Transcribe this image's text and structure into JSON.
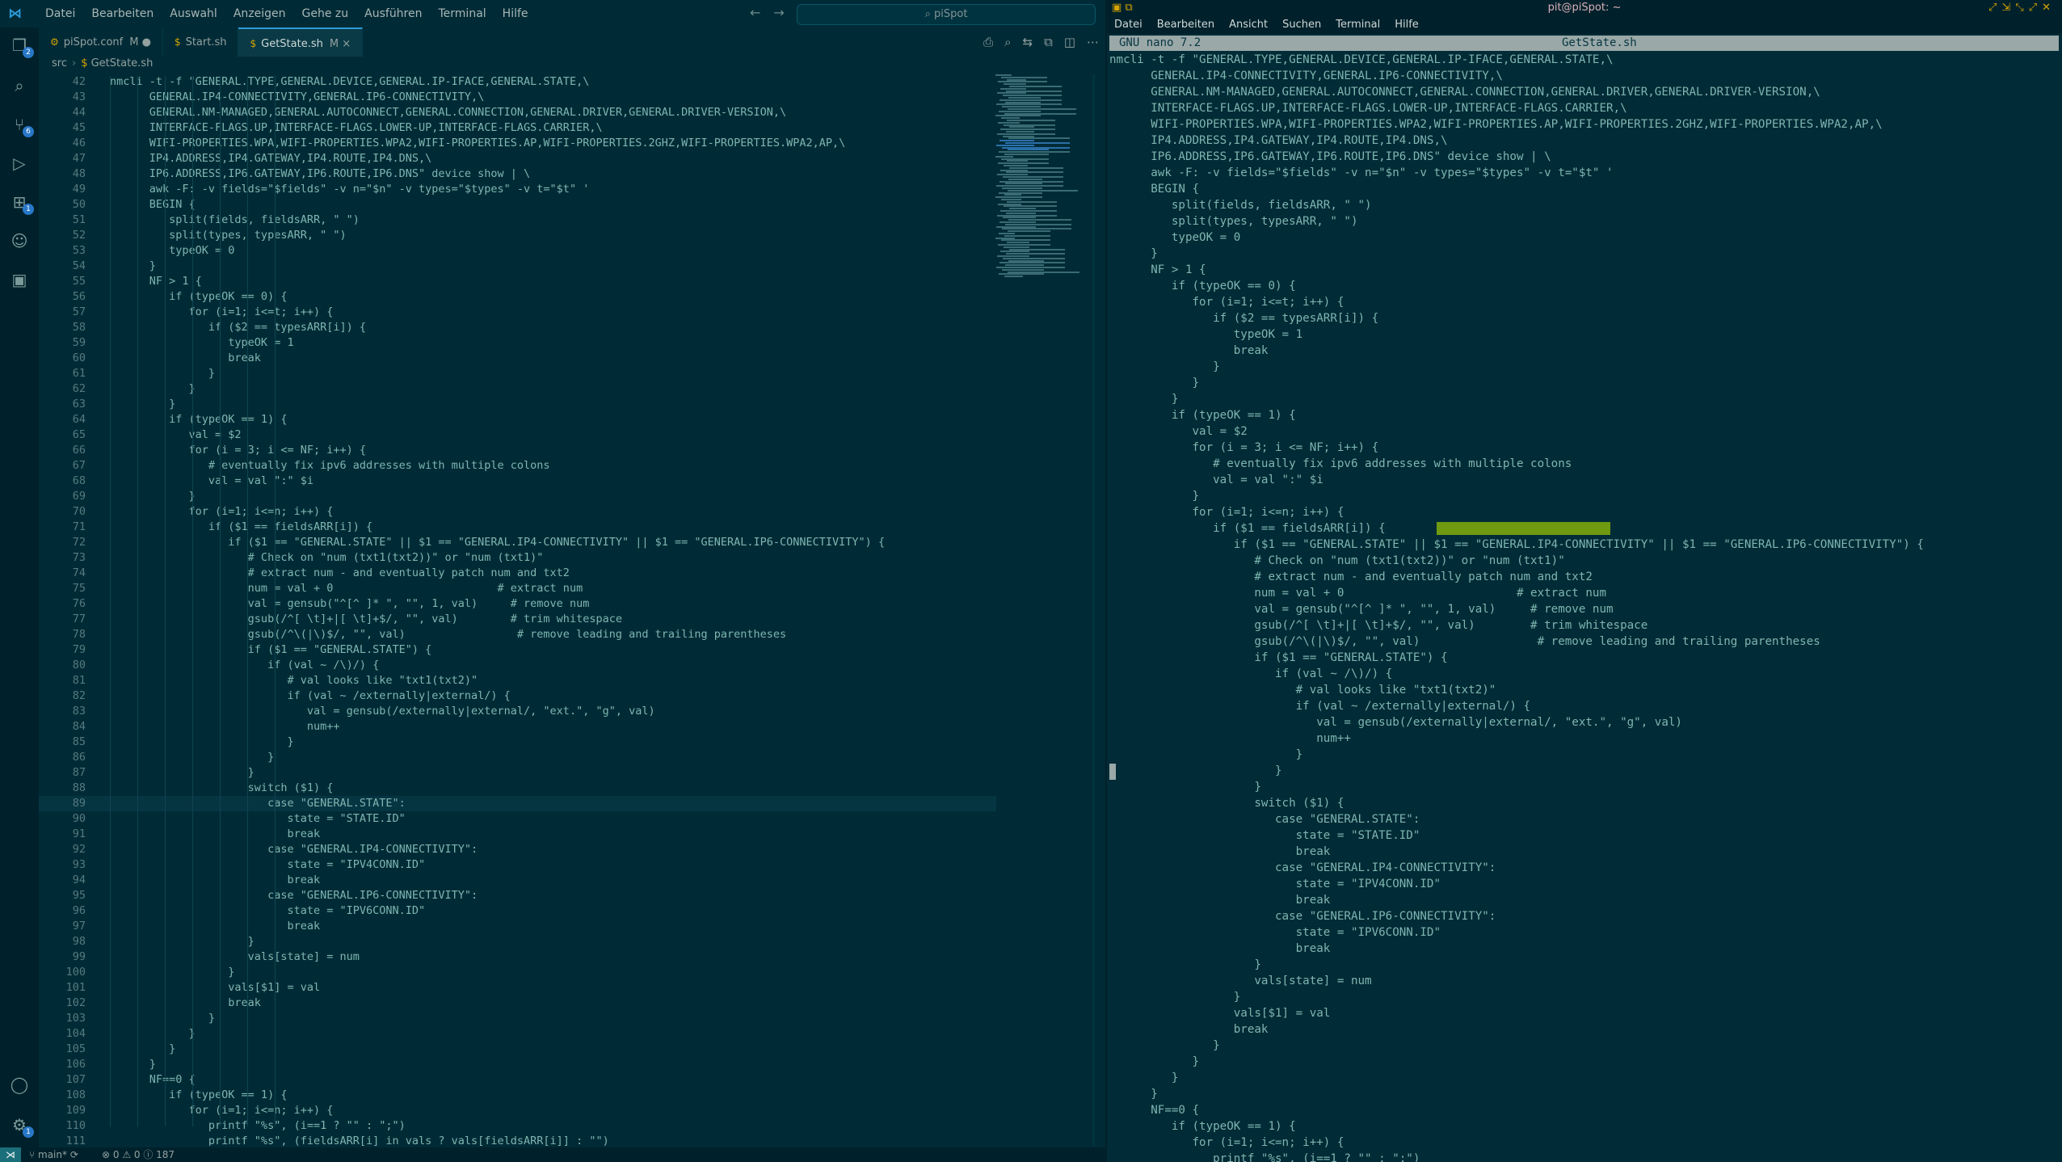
{
  "vscode": {
    "menu": [
      "Datei",
      "Bearbeiten",
      "Auswahl",
      "Anzeigen",
      "Gehe zu",
      "Ausführen",
      "Terminal",
      "Hilfe"
    ],
    "search_label": "piSpot",
    "tabs": [
      {
        "label": "piSpot.conf",
        "suffix": "M ●"
      },
      {
        "label": "Start.sh",
        "suffix": ""
      },
      {
        "label": "GetState.sh",
        "suffix": "M ×"
      }
    ],
    "breadcrumb": [
      "src",
      "GetState.sh"
    ],
    "badges": {
      "explorer": "2",
      "scm": "6",
      "extensions": "1",
      "settings": "1"
    },
    "status": {
      "branch": "main*",
      "problems": "⊗ 0 ⚠ 0 ⓘ 187"
    },
    "current_line": 89,
    "lines": [
      {
        "n": "42",
        "t": "nmcli -t -f \"GENERAL.TYPE,GENERAL.DEVICE,GENERAL.IP-IFACE,GENERAL.STATE,\\"
      },
      {
        "n": "43",
        "t": "      GENERAL.IP4-CONNECTIVITY,GENERAL.IP6-CONNECTIVITY,\\"
      },
      {
        "n": "44",
        "t": "      GENERAL.NM-MANAGED,GENERAL.AUTOCONNECT,GENERAL.CONNECTION,GENERAL.DRIVER,GENERAL.DRIVER-VERSION,\\"
      },
      {
        "n": "45",
        "t": "      INTERFACE-FLAGS.UP,INTERFACE-FLAGS.LOWER-UP,INTERFACE-FLAGS.CARRIER,\\"
      },
      {
        "n": "46",
        "t": "      WIFI-PROPERTIES.WPA,WIFI-PROPERTIES.WPA2,WIFI-PROPERTIES.AP,WIFI-PROPERTIES.2GHZ,WIFI-PROPERTIES.WPA2,AP,\\"
      },
      {
        "n": "47",
        "t": "      IP4.ADDRESS,IP4.GATEWAY,IP4.ROUTE,IP4.DNS,\\"
      },
      {
        "n": "48",
        "t": "      IP6.ADDRESS,IP6.GATEWAY,IP6.ROUTE,IP6.DNS\" device show | \\"
      },
      {
        "n": "49",
        "t": "      awk -F: -v fields=\"$fields\" -v n=\"$n\" -v types=\"$types\" -v t=\"$t\" '"
      },
      {
        "n": "50",
        "t": "      BEGIN {"
      },
      {
        "n": "51",
        "t": "         split(fields, fieldsARR, \" \")"
      },
      {
        "n": "52",
        "t": "         split(types, typesARR, \" \")"
      },
      {
        "n": "53",
        "t": "         typeOK = 0"
      },
      {
        "n": "54",
        "t": "      }"
      },
      {
        "n": "55",
        "t": "      NF > 1 {"
      },
      {
        "n": "56",
        "t": "         if (typeOK == 0) {"
      },
      {
        "n": "57",
        "t": "            for (i=1; i<=t; i++) {"
      },
      {
        "n": "58",
        "t": "               if ($2 == typesARR[i]) {"
      },
      {
        "n": "59",
        "t": "                  typeOK = 1"
      },
      {
        "n": "60",
        "t": "                  break"
      },
      {
        "n": "61",
        "t": "               }"
      },
      {
        "n": "62",
        "t": "            }"
      },
      {
        "n": "63",
        "t": "         }"
      },
      {
        "n": "64",
        "t": "         if (typeOK == 1) {"
      },
      {
        "n": "65",
        "t": "            val = $2"
      },
      {
        "n": "66",
        "t": "            for (i = 3; i <= NF; i++) {"
      },
      {
        "n": "67",
        "t": "               # eventually fix ipv6 addresses with multiple colons"
      },
      {
        "n": "68",
        "t": "               val = val \":\" $i"
      },
      {
        "n": "69",
        "t": "            }"
      },
      {
        "n": "70",
        "t": "            for (i=1; i<=n; i++) {"
      },
      {
        "n": "71",
        "t": "               if ($1 == fieldsARR[i]) {"
      },
      {
        "n": "72",
        "t": "                  if ($1 == \"GENERAL.STATE\" || $1 == \"GENERAL.IP4-CONNECTIVITY\" || $1 == \"GENERAL.IP6-CONNECTIVITY\") {"
      },
      {
        "n": "73",
        "t": "                     # Check on \"num (txt1(txt2))\" or \"num (txt1)\""
      },
      {
        "n": "74",
        "t": "                     # extract num - and eventually patch num and txt2"
      },
      {
        "n": "75",
        "t": "                     num = val + 0                         # extract num"
      },
      {
        "n": "76",
        "t": "                     val = gensub(\"^[^ ]* \", \"\", 1, val)     # remove num"
      },
      {
        "n": "77",
        "t": "                     gsub(/^[ \\t]+|[ \\t]+$/, \"\", val)        # trim whitespace"
      },
      {
        "n": "78",
        "t": "                     gsub(/^\\(|\\)$/, \"\", val)                 # remove leading and trailing parentheses"
      },
      {
        "n": "79",
        "t": "                     if ($1 == \"GENERAL.STATE\") {"
      },
      {
        "n": "80",
        "t": "                        if (val ~ /\\)/) {"
      },
      {
        "n": "81",
        "t": "                           # val looks like \"txt1(txt2)\""
      },
      {
        "n": "82",
        "t": "                           if (val ~ /externally|external/) {"
      },
      {
        "n": "83",
        "t": "                              val = gensub(/externally|external/, \"ext.\", \"g\", val)"
      },
      {
        "n": "84",
        "t": "                              num++"
      },
      {
        "n": "85",
        "t": "                           }"
      },
      {
        "n": "86",
        "t": "                        }"
      },
      {
        "n": "87",
        "t": "                     }"
      },
      {
        "n": "88",
        "t": "                     switch ($1) {"
      },
      {
        "n": "89",
        "t": "                        case \"GENERAL.STATE\":"
      },
      {
        "n": "90",
        "t": "                           state = \"STATE.ID\""
      },
      {
        "n": "91",
        "t": "                           break"
      },
      {
        "n": "92",
        "t": "                        case \"GENERAL.IP4-CONNECTIVITY\":"
      },
      {
        "n": "93",
        "t": "                           state = \"IPV4CONN.ID\""
      },
      {
        "n": "94",
        "t": "                           break"
      },
      {
        "n": "95",
        "t": "                        case \"GENERAL.IP6-CONNECTIVITY\":"
      },
      {
        "n": "96",
        "t": "                           state = \"IPV6CONN.ID\""
      },
      {
        "n": "97",
        "t": "                           break"
      },
      {
        "n": "98",
        "t": "                     }"
      },
      {
        "n": "99",
        "t": "                     vals[state] = num"
      },
      {
        "n": "100",
        "t": "                  }"
      },
      {
        "n": "101",
        "t": "                  vals[$1] = val"
      },
      {
        "n": "102",
        "t": "                  break"
      },
      {
        "n": "103",
        "t": "               }"
      },
      {
        "n": "104",
        "t": "            }"
      },
      {
        "n": "105",
        "t": "         }"
      },
      {
        "n": "106",
        "t": "      }"
      },
      {
        "n": "107",
        "t": "      NF==0 {"
      },
      {
        "n": "108",
        "t": "         if (typeOK == 1) {"
      },
      {
        "n": "109",
        "t": "            for (i=1; i<=n; i++) {"
      },
      {
        "n": "110",
        "t": "               printf \"%s\", (i==1 ? \"\" : \";\")"
      },
      {
        "n": "111",
        "t": "               printf \"%s\", (fieldsARR[i] in vals ? vals[fieldsARR[i]] : \"\")"
      }
    ]
  },
  "terminal": {
    "title": "pit@piSpot: ~",
    "menu": [
      "Datei",
      "Bearbeiten",
      "Ansicht",
      "Suchen",
      "Terminal",
      "Hilfe"
    ],
    "nano_version": "GNU nano 7.2",
    "nano_filename": "GetState.sh",
    "lines": [
      "nmcli -t -f \"GENERAL.TYPE,GENERAL.DEVICE,GENERAL.IP-IFACE,GENERAL.STATE,\\",
      "      GENERAL.IP4-CONNECTIVITY,GENERAL.IP6-CONNECTIVITY,\\",
      "      GENERAL.NM-MANAGED,GENERAL.AUTOCONNECT,GENERAL.CONNECTION,GENERAL.DRIVER,GENERAL.DRIVER-VERSION,\\",
      "      INTERFACE-FLAGS.UP,INTERFACE-FLAGS.LOWER-UP,INTERFACE-FLAGS.CARRIER,\\",
      "      WIFI-PROPERTIES.WPA,WIFI-PROPERTIES.WPA2,WIFI-PROPERTIES.AP,WIFI-PROPERTIES.2GHZ,WIFI-PROPERTIES.WPA2,AP,\\",
      "      IP4.ADDRESS,IP4.GATEWAY,IP4.ROUTE,IP4.DNS,\\",
      "      IP6.ADDRESS,IP6.GATEWAY,IP6.ROUTE,IP6.DNS\" device show | \\",
      "      awk -F: -v fields=\"$fields\" -v n=\"$n\" -v types=\"$types\" -v t=\"$t\" '",
      "      BEGIN {",
      "         split(fields, fieldsARR, \" \")",
      "         split(types, typesARR, \" \")",
      "         typeOK = 0",
      "      }",
      "      NF > 1 {",
      "         if (typeOK == 0) {",
      "            for (i=1; i<=t; i++) {",
      "               if ($2 == typesARR[i]) {",
      "                  typeOK = 1",
      "                  break",
      "               }",
      "            }",
      "         }",
      "         if (typeOK == 1) {",
      "            val = $2",
      "            for (i = 3; i <= NF; i++) {",
      "               # eventually fix ipv6 addresses with multiple colons",
      "               val = val \":\" $i",
      "            }",
      "            for (i=1; i<=n; i++) {",
      "               if ($1 == fieldsARR[i]) {",
      "                  if ($1 == \"GENERAL.STATE\" || $1 == \"GENERAL.IP4-CONNECTIVITY\" || $1 == \"GENERAL.IP6-CONNECTIVITY\") {",
      "                     # Check on \"num (txt1(txt2))\" or \"num (txt1)\"",
      "                     # extract num - and eventually patch num and txt2",
      "                     num = val + 0                         # extract num",
      "                     val = gensub(\"^[^ ]* \", \"\", 1, val)     # remove num",
      "                     gsub(/^[ \\t]+|[ \\t]+$/, \"\", val)        # trim whitespace",
      "                     gsub(/^\\(|\\)$/, \"\", val)                 # remove leading and trailing parentheses",
      "                     if ($1 == \"GENERAL.STATE\") {",
      "                        if (val ~ /\\)/) {",
      "                           # val looks like \"txt1(txt2)\"",
      "                           if (val ~ /externally|external/) {",
      "                              val = gensub(/externally|external/, \"ext.\", \"g\", val)",
      "                              num++",
      "                           }",
      "                        }",
      "                     }",
      "                     switch ($1) {",
      "                        case \"GENERAL.STATE\":",
      "                           state = \"STATE.ID\"",
      "                           break",
      "                        case \"GENERAL.IP4-CONNECTIVITY\":",
      "                           state = \"IPV4CONN.ID\"",
      "                           break",
      "                        case \"GENERAL.IP6-CONNECTIVITY\":",
      "                           state = \"IPV6CONN.ID\"",
      "                           break",
      "                     }",
      "                     vals[state] = num",
      "                  }",
      "                  vals[$1] = val",
      "                  break",
      "               }",
      "            }",
      "         }",
      "      }",
      "      NF==0 {",
      "         if (typeOK == 1) {",
      "            for (i=1; i<=n; i++) {",
      "               printf \"%s\", (i==1 ? \"\" : \";\")"
    ]
  },
  "colors": {
    "accent": "#2b9bd8",
    "nano_highlight": "#6f9a10",
    "string": "#c8d000",
    "keyword": "#dc322f"
  }
}
